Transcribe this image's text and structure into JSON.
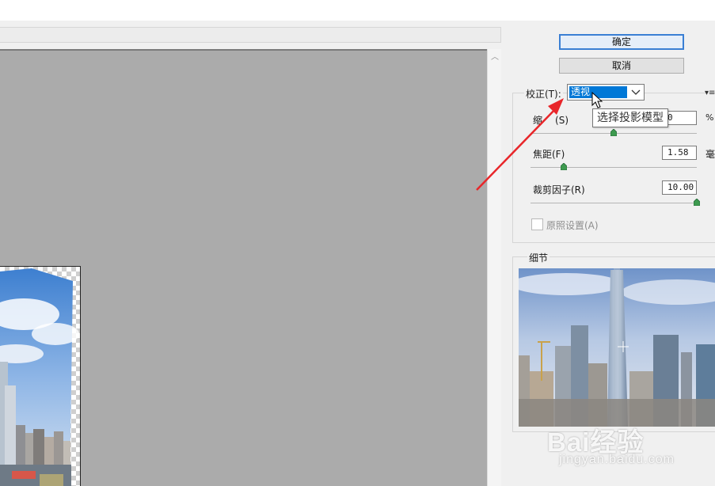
{
  "buttons": {
    "ok_label": "确定",
    "cancel_label": "取消"
  },
  "correction": {
    "label": "校正(T):",
    "selected_value": "透视",
    "menu_icon": "panel-menu-icon"
  },
  "tooltip": {
    "text": "选择投影模型"
  },
  "params": {
    "scale": {
      "label_prefix": "缩",
      "label_suffix": "(S)",
      "value": "0",
      "unit": "%",
      "slider_fraction": 0.5
    },
    "focal": {
      "label": "焦距(F)",
      "value": "1.58",
      "unit": "毫",
      "slider_fraction": 0.2
    },
    "crop": {
      "label": "裁剪因子(R)",
      "value": "10.00",
      "slider_fraction": 1.0
    }
  },
  "checkbox": {
    "label": "原照设置(A)",
    "checked": false
  },
  "detail": {
    "label": "细节"
  },
  "watermark": {
    "logo": "Bai经验",
    "sub": "jingyan.baidu.com"
  },
  "colors": {
    "accent": "#0078d7",
    "arrow": "#e8262a",
    "canvas": "#ababab"
  }
}
